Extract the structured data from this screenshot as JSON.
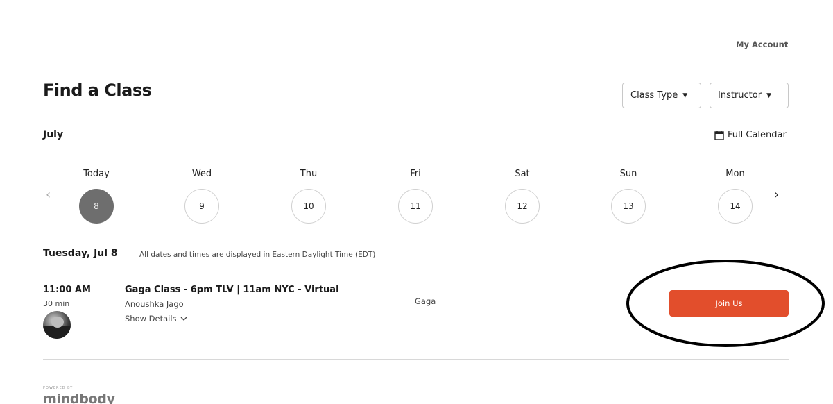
{
  "header": {
    "my_account": "My Account",
    "title": "Find a Class"
  },
  "filters": {
    "class_type": "Class Type",
    "instructor": "Instructor"
  },
  "calendar": {
    "month": "July",
    "full_calendar": "Full Calendar",
    "days": [
      {
        "name": "Today",
        "num": "8",
        "selected": true
      },
      {
        "name": "Wed",
        "num": "9"
      },
      {
        "name": "Thu",
        "num": "10"
      },
      {
        "name": "Fri",
        "num": "11"
      },
      {
        "name": "Sat",
        "num": "12"
      },
      {
        "name": "Sun",
        "num": "13"
      },
      {
        "name": "Mon",
        "num": "14"
      }
    ]
  },
  "schedule": {
    "date_heading": "Tuesday, Jul 8",
    "timezone_note": "All dates and times are displayed in Eastern Daylight Time (EDT)",
    "classes": [
      {
        "time": "11:00 AM",
        "duration": "30 min",
        "name": "Gaga Class - 6pm TLV | 11am NYC - Virtual",
        "instructor": "Anoushka Jago",
        "show_details": "Show Details",
        "category": "Gaga",
        "action": "Join Us"
      }
    ]
  },
  "footer": {
    "powered_by": "POWERED BY",
    "brand": "mindbody"
  },
  "colors": {
    "accent": "#e24e2c",
    "selected_day": "#6e6e6e"
  }
}
